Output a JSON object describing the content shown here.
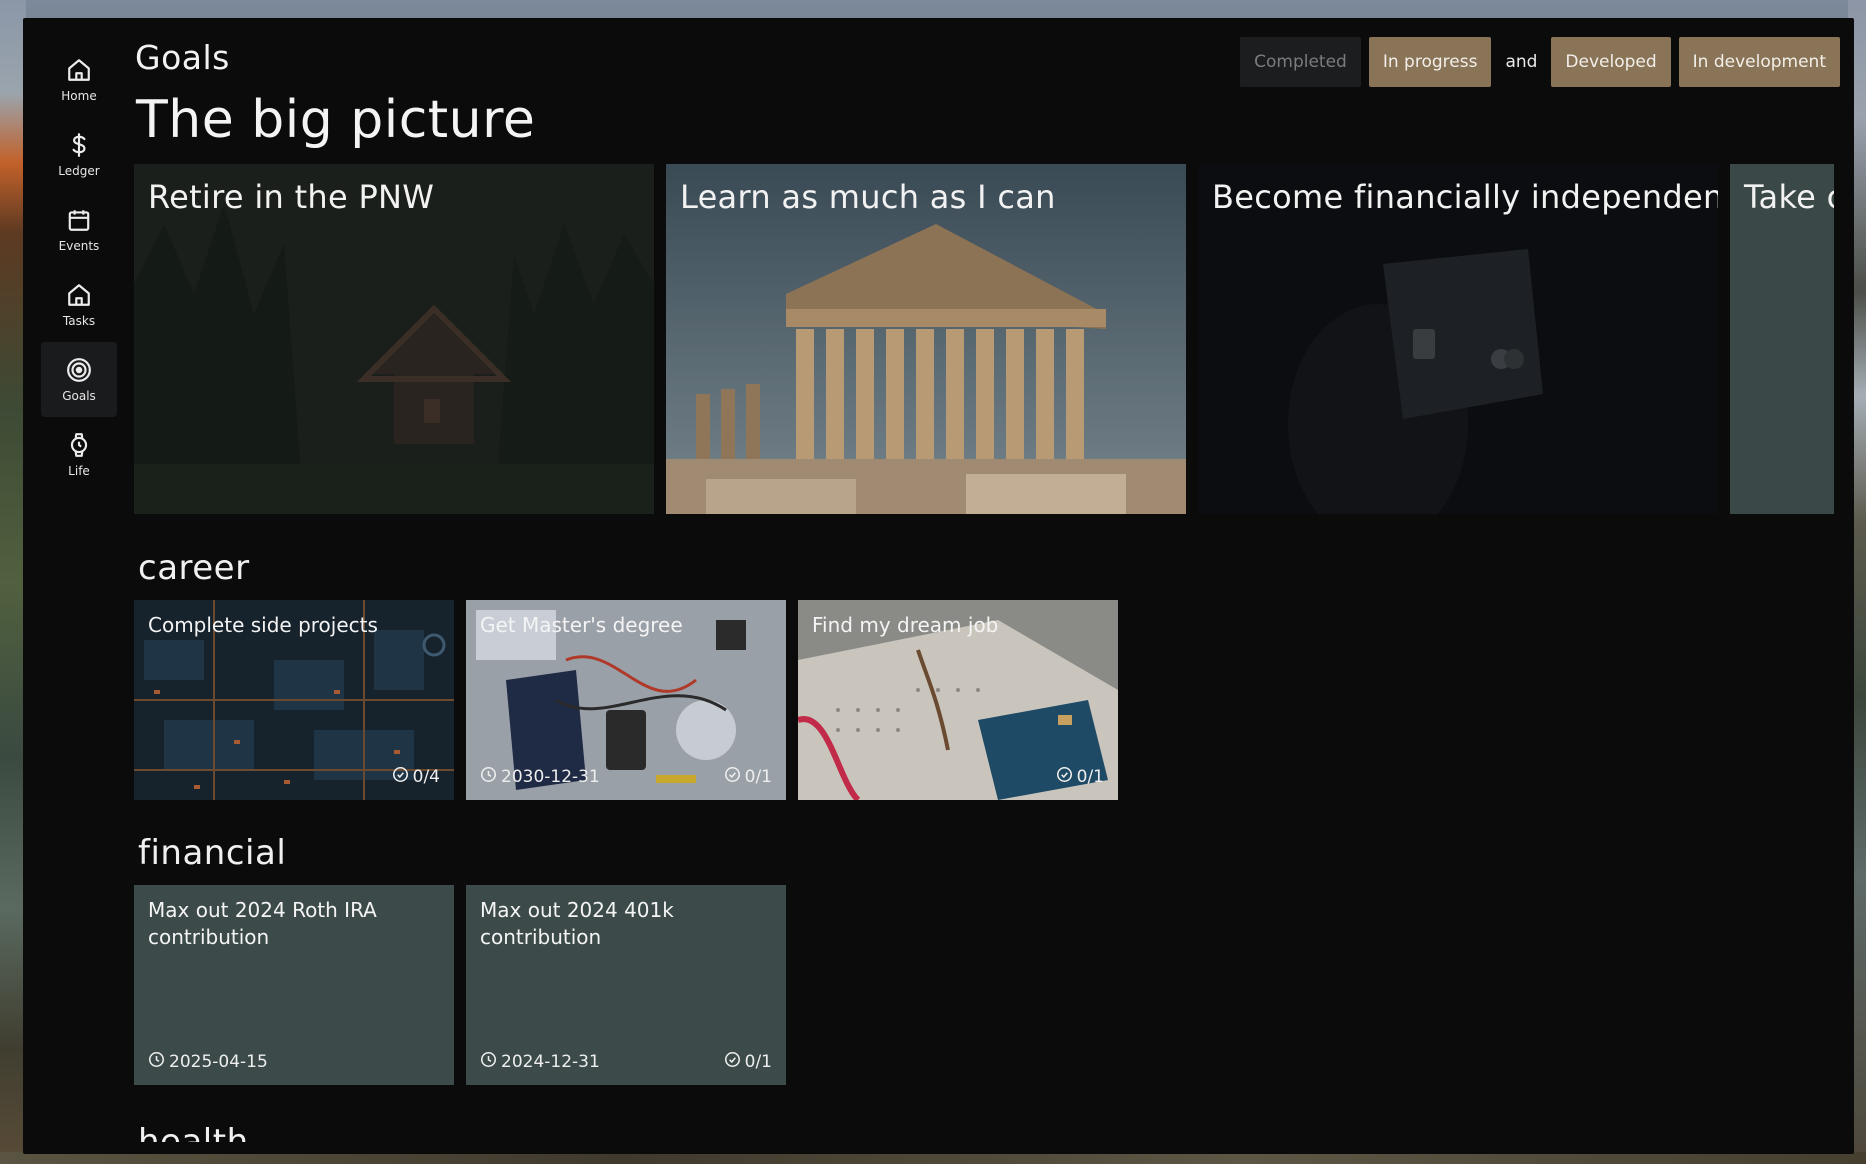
{
  "sidebar": {
    "items": [
      {
        "label": "Home",
        "icon": "home-icon"
      },
      {
        "label": "Ledger",
        "icon": "dollar-icon"
      },
      {
        "label": "Events",
        "icon": "calendar-icon"
      },
      {
        "label": "Tasks",
        "icon": "home-icon"
      },
      {
        "label": "Goals",
        "icon": "target-icon",
        "active": true
      },
      {
        "label": "Life",
        "icon": "watch-icon"
      }
    ]
  },
  "header": {
    "title": "Goals",
    "subtitle": "The big picture"
  },
  "filters": {
    "completed": "Completed",
    "in_progress": "In progress",
    "and": "and",
    "developed": "Developed",
    "in_development": "In development"
  },
  "big_picture": [
    {
      "title": "Retire in the PNW"
    },
    {
      "title": "Learn as much as I can"
    },
    {
      "title": "Become financially independent"
    },
    {
      "title": "Take c"
    }
  ],
  "sections": {
    "career": {
      "title": "career",
      "goals": [
        {
          "title": "Complete side projects",
          "date": "",
          "progress": "0/4"
        },
        {
          "title": "Get Master's degree",
          "date": "2030-12-31",
          "progress": "0/1"
        },
        {
          "title": "Find my dream job",
          "date": "",
          "progress": "0/1"
        }
      ]
    },
    "financial": {
      "title": "financial",
      "goals": [
        {
          "title": "Max out 2024 Roth IRA contribution",
          "date": "2025-04-15",
          "progress": ""
        },
        {
          "title": "Max out 2024 401k contribution",
          "date": "2024-12-31",
          "progress": "0/1"
        }
      ]
    },
    "health": {
      "title": "health"
    }
  },
  "colors": {
    "window_bg": "#0b0b0c",
    "chip_tan": "#8a7458",
    "chip_muted": "#1c1d1f",
    "card_slate": "#3c4a4a"
  }
}
